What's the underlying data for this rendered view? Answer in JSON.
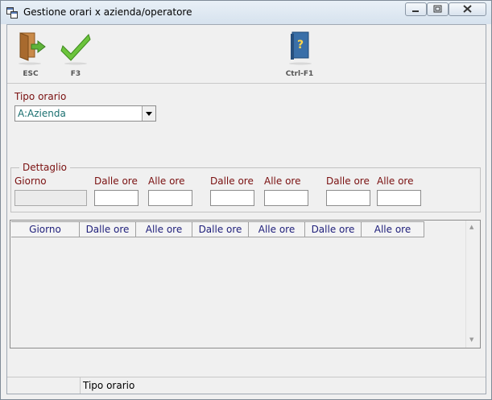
{
  "window": {
    "title": "Gestione orari x azienda/operatore"
  },
  "toolbar": {
    "buttons": [
      {
        "label": "ESC",
        "icon": "exit-door-icon"
      },
      {
        "label": "F3",
        "icon": "checkmark-icon"
      },
      {
        "label": "Ctrl-F1",
        "icon": "help-book-icon"
      }
    ]
  },
  "tipo_orario": {
    "label": "Tipo orario",
    "value": "A:Azienda"
  },
  "dettaglio": {
    "legend": "Dettaglio",
    "labels": [
      "Giorno",
      "Dalle ore",
      "Alle ore",
      "Dalle ore",
      "Alle ore",
      "Dalle ore",
      "Alle ore"
    ]
  },
  "grid": {
    "columns": [
      "Giorno",
      "Dalle ore",
      "Alle ore",
      "Dalle ore",
      "Alle ore",
      "Dalle ore",
      "Alle ore"
    ]
  },
  "statusbar": {
    "text": "Tipo orario"
  },
  "colors": {
    "label_red": "#7a1010",
    "header_blue": "#1e1e7a",
    "combo_teal": "#1a6f6f"
  }
}
